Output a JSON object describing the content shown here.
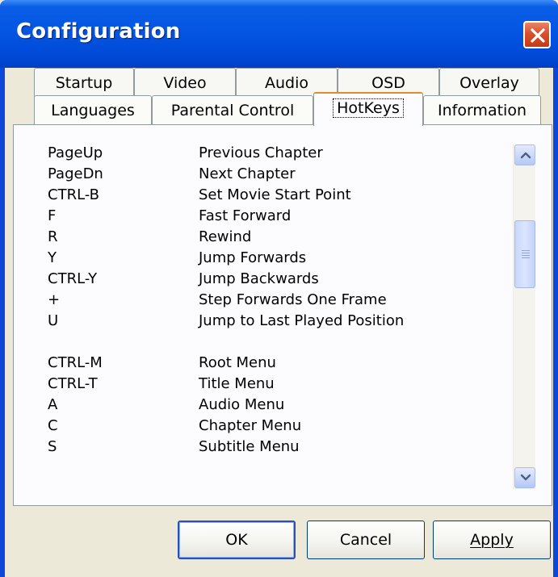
{
  "window": {
    "title": "Configuration"
  },
  "tabs": {
    "row1": [
      {
        "label": "Startup"
      },
      {
        "label": "Video"
      },
      {
        "label": "Audio"
      },
      {
        "label": "OSD"
      },
      {
        "label": "Overlay"
      }
    ],
    "row2": [
      {
        "label": "Languages"
      },
      {
        "label": "Parental Control"
      },
      {
        "label": "HotKeys",
        "selected": true
      },
      {
        "label": "Information"
      }
    ]
  },
  "hotkeys": [
    {
      "key": "PageUp",
      "action": "Previous Chapter"
    },
    {
      "key": "PageDn",
      "action": "Next Chapter"
    },
    {
      "key": "CTRL-B",
      "action": "Set Movie Start Point"
    },
    {
      "key": "F",
      "action": "Fast Forward"
    },
    {
      "key": "R",
      "action": "Rewind"
    },
    {
      "key": "Y",
      "action": "Jump Forwards"
    },
    {
      "key": "CTRL-Y",
      "action": "Jump Backwards"
    },
    {
      "key": "+",
      "action": "Step Forwards One Frame"
    },
    {
      "key": "U",
      "action": "Jump to Last Played Position"
    },
    {
      "key": "",
      "action": ""
    },
    {
      "key": "CTRL-M",
      "action": "Root Menu"
    },
    {
      "key": "CTRL-T",
      "action": "Title Menu"
    },
    {
      "key": "A",
      "action": "Audio Menu"
    },
    {
      "key": "C",
      "action": "Chapter Menu"
    },
    {
      "key": "S",
      "action": "Subtitle Menu"
    }
  ],
  "buttons": {
    "ok": "OK",
    "cancel": "Cancel",
    "apply": "Apply"
  },
  "icons": {
    "close": "close-icon",
    "scroll_up": "chevron-up-icon",
    "scroll_down": "chevron-down-icon"
  },
  "colors": {
    "title_bar": "#0454e2",
    "close_button": "#d8502d",
    "active_tab_accent": "#e68b2c",
    "dialog_face": "#ece9d8",
    "scroll_thumb": "#c9d7fb"
  }
}
